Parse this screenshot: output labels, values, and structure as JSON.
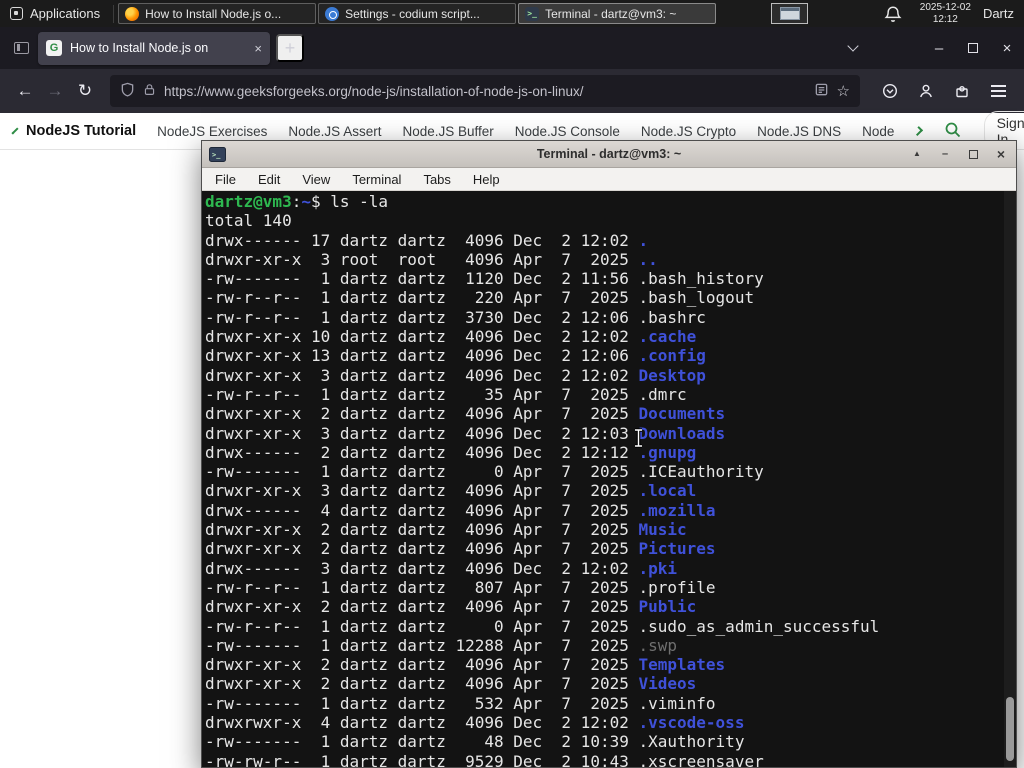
{
  "colors": {
    "gfg_green": "#2f8d46",
    "terminal_dir_blue": "#3f51d9",
    "terminal_prompt_green": "#2eb850",
    "terminal_dim_gray": "#6f6f6f",
    "firefox_chrome": "#1c1b22",
    "firefox_toolbar": "#2b2a33"
  },
  "panel": {
    "applications_label": "Applications",
    "taskbar": [
      {
        "title": "How to Install Node.js o...",
        "icon": "firefox-icon"
      },
      {
        "title": "Settings - codium script...",
        "icon": "settings-icon"
      },
      {
        "title": "Terminal - dartz@vm3: ~",
        "icon": "terminal-icon"
      }
    ],
    "clock_date": "2025-12-02",
    "clock_time": "12:12",
    "user": "Dartz"
  },
  "browser": {
    "tab_title": "How to Install Node.js on",
    "url": "https://www.geeksforgeeks.org/node-js/installation-of-node-js-on-linux/"
  },
  "site_nav": {
    "items": [
      "NodeJS Tutorial",
      "NodeJS Exercises",
      "Node.JS Assert",
      "Node.JS Buffer",
      "Node.JS Console",
      "Node.JS Crypto",
      "Node.JS DNS",
      "Node"
    ],
    "sign_in_label": "Sign In"
  },
  "terminal": {
    "title": "Terminal - dartz@vm3: ~",
    "menu": [
      "File",
      "Edit",
      "View",
      "Terminal",
      "Tabs",
      "Help"
    ],
    "prompt": {
      "user_host": "dartz@vm3",
      "colon": ":",
      "path": "~",
      "dollar": "$ ",
      "command": "ls -la"
    },
    "total_line": "total 140",
    "entries": [
      {
        "m": "drwx------ 17 dartz dartz  4096 Dec  2 12:02 ",
        "n": ".",
        "k": "d"
      },
      {
        "m": "drwxr-xr-x  3 root  root   4096 Apr  7  2025 ",
        "n": "..",
        "k": "d"
      },
      {
        "m": "-rw-------  1 dartz dartz  1120 Dec  2 11:56 ",
        "n": ".bash_history",
        "k": "f"
      },
      {
        "m": "-rw-r--r--  1 dartz dartz   220 Apr  7  2025 ",
        "n": ".bash_logout",
        "k": "f"
      },
      {
        "m": "-rw-r--r--  1 dartz dartz  3730 Dec  2 12:06 ",
        "n": ".bashrc",
        "k": "f"
      },
      {
        "m": "drwxr-xr-x 10 dartz dartz  4096 Dec  2 12:02 ",
        "n": ".cache",
        "k": "d"
      },
      {
        "m": "drwxr-xr-x 13 dartz dartz  4096 Dec  2 12:06 ",
        "n": ".config",
        "k": "d"
      },
      {
        "m": "drwxr-xr-x  3 dartz dartz  4096 Dec  2 12:02 ",
        "n": "Desktop",
        "k": "d"
      },
      {
        "m": "-rw-r--r--  1 dartz dartz    35 Apr  7  2025 ",
        "n": ".dmrc",
        "k": "f"
      },
      {
        "m": "drwxr-xr-x  2 dartz dartz  4096 Apr  7  2025 ",
        "n": "Documents",
        "k": "d"
      },
      {
        "m": "drwxr-xr-x  3 dartz dartz  4096 Dec  2 12:03 ",
        "n": "Downloads",
        "k": "d"
      },
      {
        "m": "drwx------  2 dartz dartz  4096 Dec  2 12:12 ",
        "n": ".gnupg",
        "k": "d"
      },
      {
        "m": "-rw-------  1 dartz dartz     0 Apr  7  2025 ",
        "n": ".ICEauthority",
        "k": "f"
      },
      {
        "m": "drwxr-xr-x  3 dartz dartz  4096 Apr  7  2025 ",
        "n": ".local",
        "k": "d"
      },
      {
        "m": "drwx------  4 dartz dartz  4096 Apr  7  2025 ",
        "n": ".mozilla",
        "k": "d"
      },
      {
        "m": "drwxr-xr-x  2 dartz dartz  4096 Apr  7  2025 ",
        "n": "Music",
        "k": "d"
      },
      {
        "m": "drwxr-xr-x  2 dartz dartz  4096 Apr  7  2025 ",
        "n": "Pictures",
        "k": "d"
      },
      {
        "m": "drwx------  3 dartz dartz  4096 Dec  2 12:02 ",
        "n": ".pki",
        "k": "d"
      },
      {
        "m": "-rw-r--r--  1 dartz dartz   807 Apr  7  2025 ",
        "n": ".profile",
        "k": "f"
      },
      {
        "m": "drwxr-xr-x  2 dartz dartz  4096 Apr  7  2025 ",
        "n": "Public",
        "k": "d"
      },
      {
        "m": "-rw-r--r--  1 dartz dartz     0 Apr  7  2025 ",
        "n": ".sudo_as_admin_successful",
        "k": "f"
      },
      {
        "m": "-rw-------  1 dartz dartz 12288 Apr  7  2025 ",
        "n": ".swp",
        "k": "x"
      },
      {
        "m": "drwxr-xr-x  2 dartz dartz  4096 Apr  7  2025 ",
        "n": "Templates",
        "k": "d"
      },
      {
        "m": "drwxr-xr-x  2 dartz dartz  4096 Apr  7  2025 ",
        "n": "Videos",
        "k": "d"
      },
      {
        "m": "-rw-------  1 dartz dartz   532 Apr  7  2025 ",
        "n": ".viminfo",
        "k": "f"
      },
      {
        "m": "drwxrwxr-x  4 dartz dartz  4096 Dec  2 12:02 ",
        "n": ".vscode-oss",
        "k": "d"
      },
      {
        "m": "-rw-------  1 dartz dartz    48 Dec  2 10:39 ",
        "n": ".Xauthority",
        "k": "f"
      },
      {
        "m": "-rw-rw-r--  1 dartz dartz  9529 Dec  2 10:43 ",
        "n": ".xscreensaver",
        "k": "f"
      }
    ]
  },
  "icons": {
    "close": "×",
    "minimize": "–",
    "shade": "▲",
    "new_tab": "+",
    "star": "☆",
    "back": "←",
    "forward": "→",
    "reload": "↻",
    "terminal_glyph": ">_",
    "favicon_letter": "G"
  }
}
